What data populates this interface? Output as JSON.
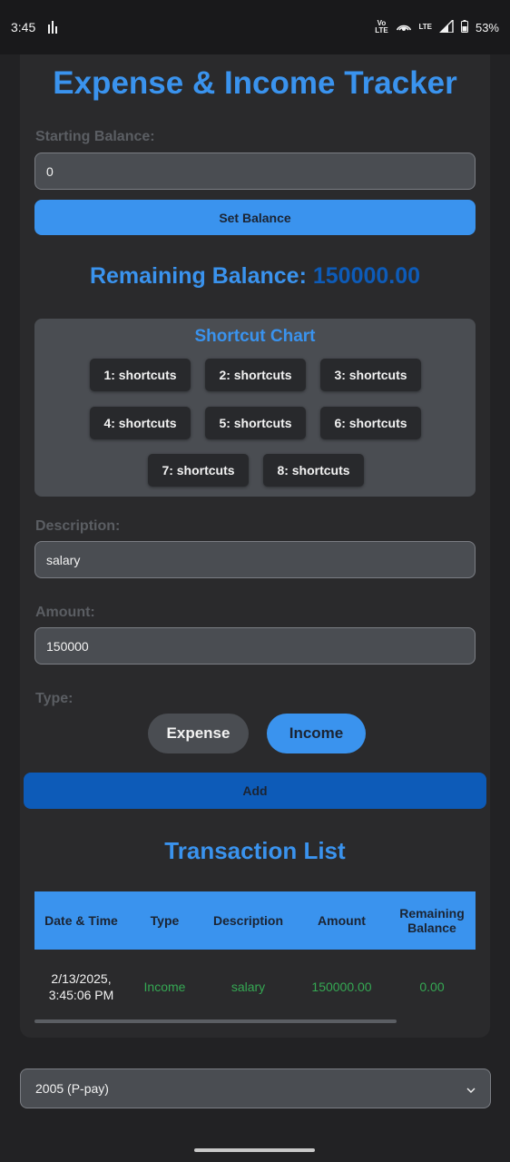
{
  "status_bar": {
    "time": "3:45",
    "volte": "Vo LTE",
    "lte": "LTE",
    "battery": "53%"
  },
  "app": {
    "title": "Expense & Income Tracker",
    "starting_balance_label": "Starting Balance:",
    "starting_balance_value": "0",
    "set_balance_label": "Set Balance",
    "remaining_label": "Remaining Balance:",
    "remaining_value": "150000.00",
    "shortcut_chart": {
      "title": "Shortcut Chart",
      "buttons": [
        "1: shortcuts",
        "2: shortcuts",
        "3: shortcuts",
        "4: shortcuts",
        "5: shortcuts",
        "6: shortcuts",
        "7: shortcuts",
        "8: shortcuts"
      ]
    },
    "description_label": "Description:",
    "description_value": "salary",
    "amount_label": "Amount:",
    "amount_value": "150000",
    "type_label": "Type:",
    "type_options": [
      "Expense",
      "Income"
    ],
    "selected_type": "Income",
    "add_label": "Add",
    "transaction_list": {
      "title": "Transaction List",
      "columns": [
        "Date & Time",
        "Type",
        "Description",
        "Amount",
        "Remaining Balance"
      ],
      "rows": [
        {
          "date": "2/13/2025, 3:45:06 PM",
          "type": "Income",
          "description": "salary",
          "amount": "150000.00",
          "remaining": "0.00"
        }
      ]
    },
    "select_value": "2005 (P-pay)"
  },
  "colors": {
    "accent": "#3a93ee",
    "accent_dark": "#0d5bb8",
    "income_green": "#35a853",
    "background": "#222224"
  }
}
